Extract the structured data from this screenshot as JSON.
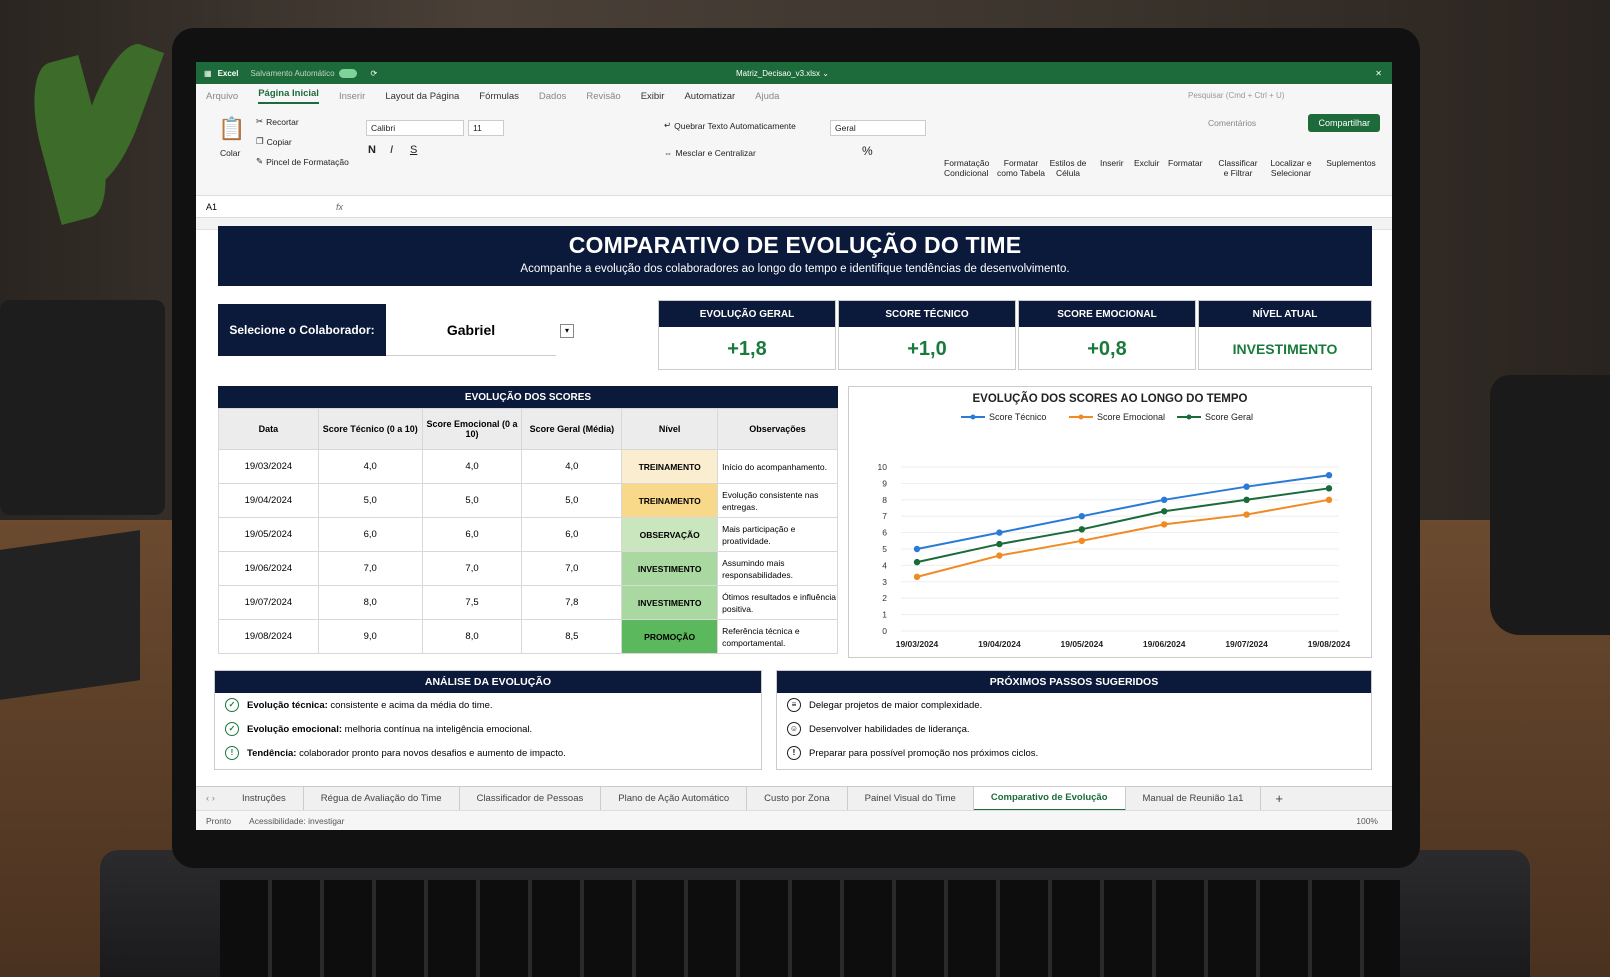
{
  "titlebar": {
    "app": "Excel",
    "autosave": "Salvamento Automático",
    "file": "Matriz_Decisao_v3.xlsx ⌄",
    "close": "✕"
  },
  "menu": [
    "Arquivo",
    "Página Inicial",
    "Inserir",
    "Layout da Página",
    "Fórmulas",
    "Dados",
    "Revisão",
    "Exibir",
    "Automatizar",
    "Ajuda"
  ],
  "search": "Pesquisar (Cmd + Ctrl + U)",
  "ribbon": {
    "paste": "Colar",
    "cut": "Recortar",
    "copy": "Copiar",
    "format_painter": "Pincel de Formatação",
    "font": "Calibri",
    "size": "11",
    "bold": "N",
    "italic": "I",
    "underline": "S",
    "wrap": "Quebrar Texto Automaticamente",
    "merge": "Mesclar e Centralizar",
    "number_format": "Geral",
    "percent": "%",
    "cond_format": "Formatação Condicional",
    "format_table": "Formatar como Tabela",
    "cell_styles": "Estilos de Célula",
    "insert": "Inserir",
    "delete": "Excluir",
    "format": "Formatar",
    "sort": "Classificar e Filtrar",
    "find": "Localizar e Selecionar",
    "addins": "Suplementos",
    "comments": "Comentários",
    "share": "Compartilhar"
  },
  "formula_bar": {
    "cell": "A1",
    "fx": "fx"
  },
  "banner": {
    "title": "COMPARATIVO DE EVOLUÇÃO DO TIME",
    "subtitle": "Acompanhe a evolução dos colaboradores ao longo do tempo e identifique tendências de desenvolvimento."
  },
  "selector": {
    "label": "Selecione o Colaborador:",
    "value": "Gabriel"
  },
  "kpis": [
    {
      "label": "EVOLUÇÃO GERAL",
      "value": "+1,8"
    },
    {
      "label": "SCORE TÉCNICO",
      "value": "+1,0"
    },
    {
      "label": "SCORE EMOCIONAL",
      "value": "+0,8"
    },
    {
      "label": "NÍVEL ATUAL",
      "value": "INVESTIMENTO"
    }
  ],
  "table": {
    "title": "EVOLUÇÃO DOS SCORES",
    "headers": [
      "Data",
      "Score Técnico (0 a 10)",
      "Score Emocional (0 a 10)",
      "Score Geral (Média)",
      "Nível",
      "Observações"
    ],
    "rows": [
      [
        "19/03/2024",
        "4,0",
        "4,0",
        "4,0",
        "TREINAMENTO",
        "Início do acompanhamento."
      ],
      [
        "19/04/2024",
        "5,0",
        "5,0",
        "5,0",
        "TREINAMENTO",
        "Evolução consistente nas entregas."
      ],
      [
        "19/05/2024",
        "6,0",
        "6,0",
        "6,0",
        "OBSERVAÇÃO",
        "Mais participação e proatividade."
      ],
      [
        "19/06/2024",
        "7,0",
        "7,0",
        "7,0",
        "INVESTIMENTO",
        "Assumindo mais responsabilidades."
      ],
      [
        "19/07/2024",
        "8,0",
        "7,5",
        "7,8",
        "INVESTIMENTO",
        "Ótimos resultados e influência positiva."
      ],
      [
        "19/08/2024",
        "9,0",
        "8,0",
        "8,5",
        "PROMOÇÃO",
        "Referência técnica e comportamental."
      ]
    ],
    "level_colors": [
      "#fbeed0",
      "#f8d98a",
      "#c9e6bf",
      "#a9d8a0",
      "#a9d8a0",
      "#5cb85c"
    ]
  },
  "chart_data": {
    "type": "line",
    "title": "EVOLUÇÃO DOS SCORES AO LONGO DO TEMPO",
    "categories": [
      "19/03/2024",
      "19/04/2024",
      "19/05/2024",
      "19/06/2024",
      "19/07/2024",
      "19/08/2024"
    ],
    "series": [
      {
        "name": "Score Técnico",
        "color": "#2a7ad8",
        "values": [
          5.0,
          6.0,
          7.0,
          8.0,
          8.8,
          9.5
        ]
      },
      {
        "name": "Score Emocional",
        "color": "#f08a24",
        "values": [
          3.3,
          4.6,
          5.5,
          6.5,
          7.1,
          8.0
        ]
      },
      {
        "name": "Score Geral",
        "color": "#1a6b3a",
        "values": [
          4.2,
          5.3,
          6.2,
          7.3,
          8.0,
          8.7
        ]
      }
    ],
    "ylim": [
      0,
      10
    ],
    "yticks": [
      "0",
      "1",
      "2",
      "3",
      "4",
      "5",
      "6",
      "7",
      "8",
      "9",
      "10"
    ],
    "legend": "top",
    "grid": true
  },
  "analysis": {
    "title": "ANÁLISE DA EVOLUÇÃO",
    "items": [
      {
        "label": "Evolução técnica:",
        "text": " consistente e acima da média do time."
      },
      {
        "label": "Evolução emocional:",
        "text": " melhoria contínua na inteligência emocional."
      },
      {
        "label": "Tendência:",
        "text": " colaborador pronto para novos desafios e aumento de impacto."
      }
    ]
  },
  "next_steps": {
    "title": "PRÓXIMOS PASSOS SUGERIDOS",
    "items": [
      "Delegar projetos de maior complexidade.",
      "Desenvolver habilidades de liderança.",
      "Preparar para possível promoção nos próximos ciclos."
    ]
  },
  "sheet_tabs": [
    "Instruções",
    "Régua de Avaliação do Time",
    "Classificador de Pessoas",
    "Plano de Ação Automático",
    "Custo por Zona",
    "Painel Visual do Time",
    "Comparativo de Evolução",
    "Manual de Reunião 1a1"
  ],
  "add_tab": "+",
  "status": {
    "ready": "Pronto",
    "accessibility": "Acessibilidade: investigar",
    "zoom": "100%"
  }
}
